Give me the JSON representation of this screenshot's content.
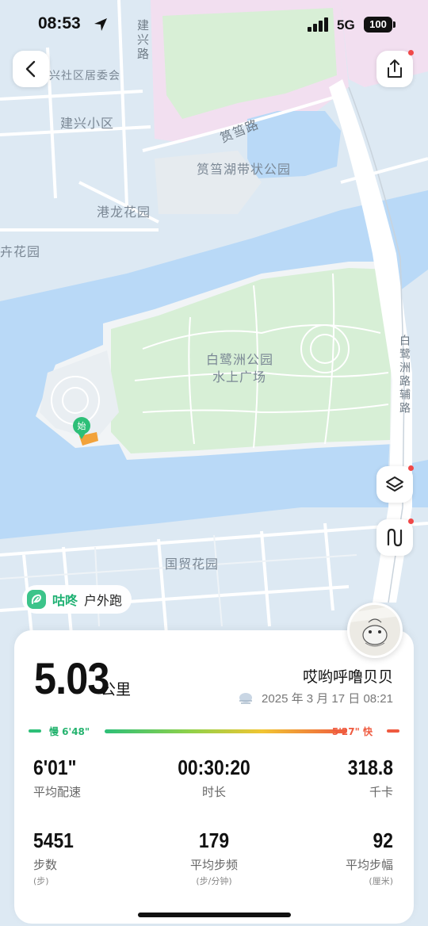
{
  "status": {
    "time": "08:53",
    "network": "5G",
    "battery": "100"
  },
  "map": {
    "labels": {
      "jianxing_road": "建兴路",
      "community_committee": "兴社区居委会",
      "jianxing_district": "建兴小区",
      "yundang_road": "筼筜路",
      "yundang_park": "筼筜湖带状公园",
      "ganglong_garden": "港龙花园",
      "huahuayuan": "卉花园",
      "bailuzhou_park_1": "白鹭洲公园",
      "bailuzhou_park_2": "水上广场",
      "bailuzhou_aux_road": "白鹭洲路辅路",
      "guomao_garden": "国贸花园"
    },
    "start_marker": "始"
  },
  "app": {
    "brand": "咕咚",
    "activity": "户外跑"
  },
  "summary": {
    "distance": "5.03",
    "distance_unit": "公里",
    "nickname": "哎哟呼噜贝贝",
    "date": "2025 年 3 月 17 日 08:21"
  },
  "pace_scale": {
    "slow_label": "慢 6'48\"",
    "fast_label": "5'27\" 快"
  },
  "stats": [
    {
      "value": "6'01\"",
      "label": "平均配速",
      "sub": ""
    },
    {
      "value": "00:30:20",
      "label": "时长",
      "sub": ""
    },
    {
      "value": "318.8",
      "label": "千卡",
      "sub": ""
    },
    {
      "value": "5451",
      "label": "步数",
      "sub": "(步)"
    },
    {
      "value": "179",
      "label": "平均步频",
      "sub": "(步/分钟)"
    },
    {
      "value": "92",
      "label": "平均步幅",
      "sub": "(厘米)"
    }
  ],
  "colors": {
    "accent_green": "#1fb173",
    "fast_red": "#ef5a3f",
    "water": "#b9d9f7",
    "park": "#d7efd6"
  }
}
